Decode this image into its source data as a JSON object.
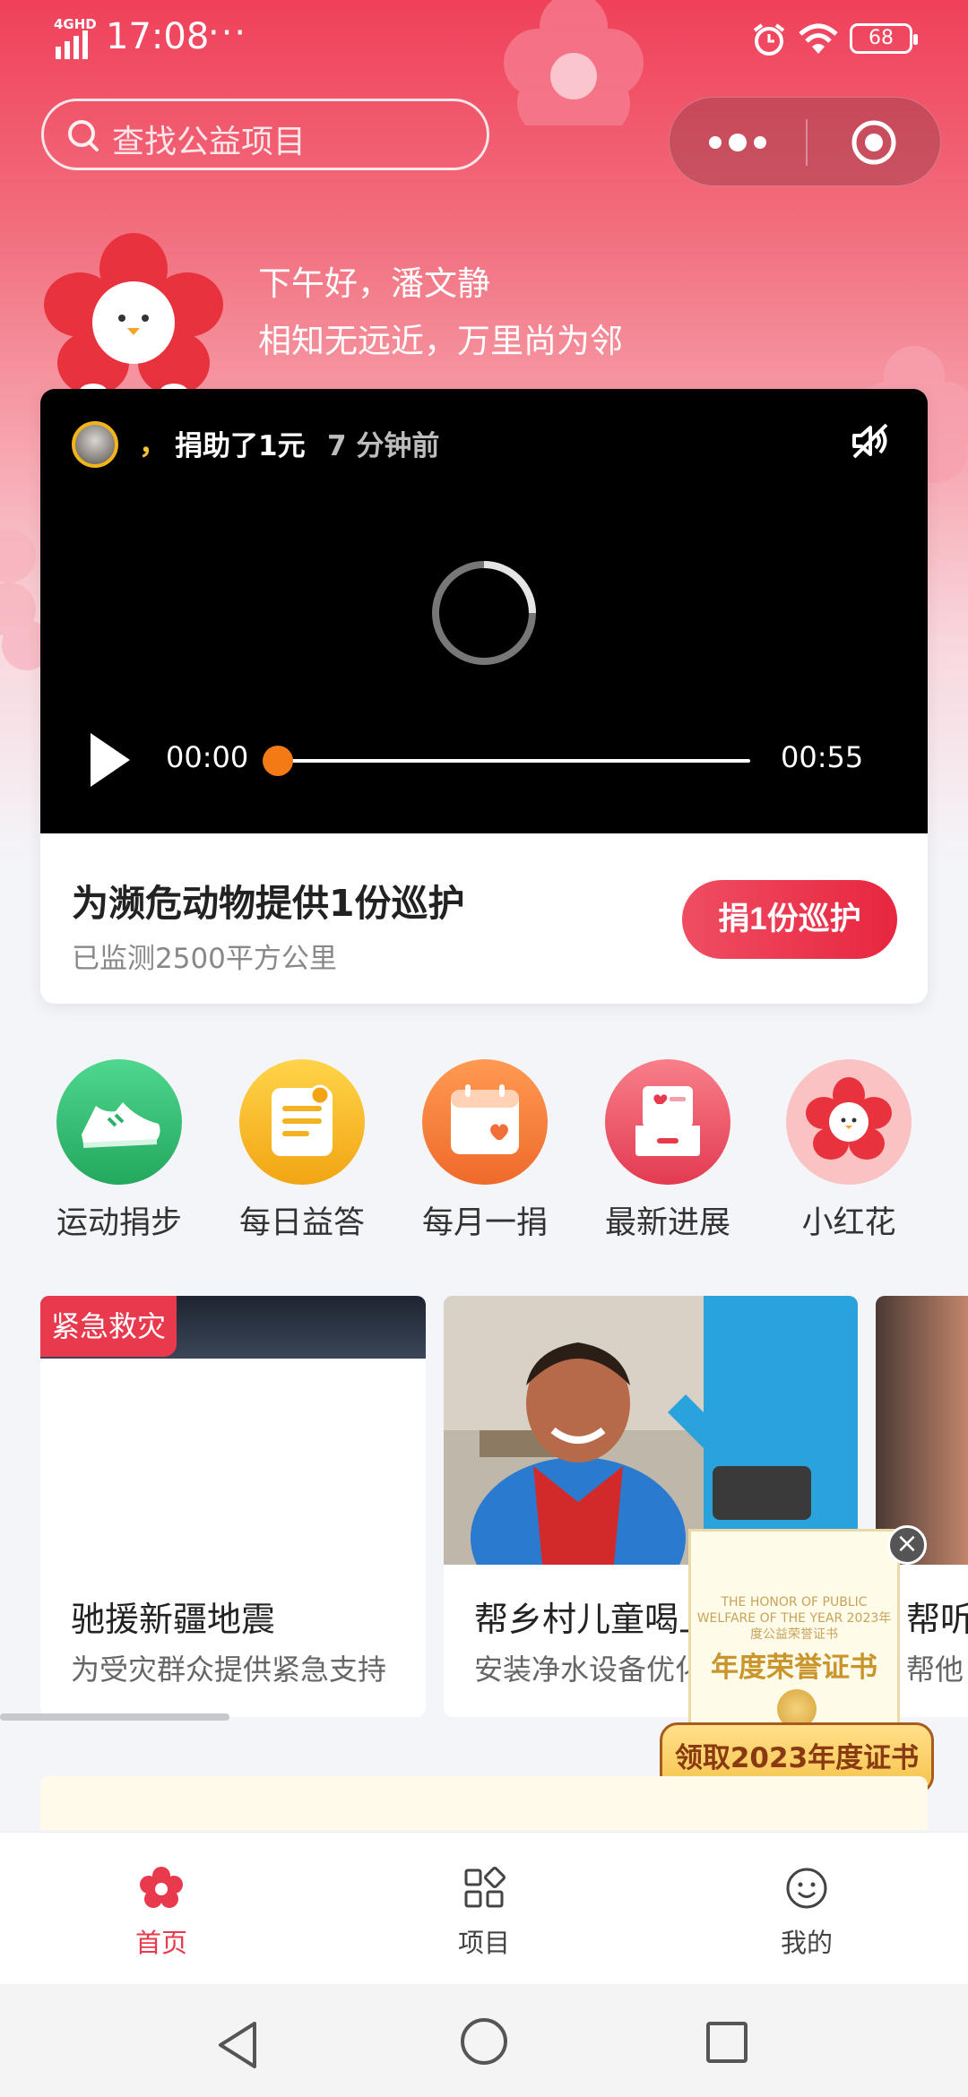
{
  "status_bar": {
    "network": "4GHD",
    "time": "17:08",
    "dots": "···",
    "battery": "68"
  },
  "search": {
    "placeholder": "查找公益项目"
  },
  "greeting": {
    "line1": "下午好，潘文静",
    "line2": "相知无远近，万里尚为邻"
  },
  "video": {
    "donor_comma": "，",
    "donation_text": "捐助了1元",
    "time_ago": "7 分钟前",
    "current_time": "00:00",
    "total_time": "00:55",
    "progress": 0
  },
  "featured_project": {
    "title": "为濒危动物提供1份巡护",
    "subtitle": "已监测2500平方公里",
    "button": "捐1份巡护"
  },
  "quick_entries": [
    {
      "label": "运动捐步",
      "icon": "sneaker-icon",
      "color": "#2fbf71"
    },
    {
      "label": "每日益答",
      "icon": "quiz-card-icon",
      "color": "#f5b31d"
    },
    {
      "label": "每月一捐",
      "icon": "calendar-heart-icon",
      "color": "#f2773a"
    },
    {
      "label": "最新进展",
      "icon": "inbox-heart-icon",
      "color": "#ea4a5d"
    },
    {
      "label": "小红花",
      "icon": "red-flower-icon",
      "color": "#f6a3a8"
    }
  ],
  "project_cards": [
    {
      "tag": "紧急救灾",
      "title": "驰援新疆地震",
      "subtitle": "为受灾群众提供紧急支持"
    },
    {
      "title": "帮乡村儿童喝上",
      "subtitle": "安装净水设备优化"
    },
    {
      "title": "帮听",
      "subtitle": "帮他"
    }
  ],
  "certificate": {
    "top_text": "THE HONOR OF PUBLIC WELFARE OF THE YEAR 2023年度公益荣誉证书",
    "main_text": "年度荣誉证书",
    "close": "×",
    "button": "领取2023年度证书"
  },
  "tabbar": {
    "items": [
      {
        "label": "首页",
        "active": true
      },
      {
        "label": "项目",
        "active": false
      },
      {
        "label": "我的",
        "active": false
      }
    ]
  },
  "colors": {
    "accent": "#e8394d",
    "progress_knob": "#f47a16"
  }
}
